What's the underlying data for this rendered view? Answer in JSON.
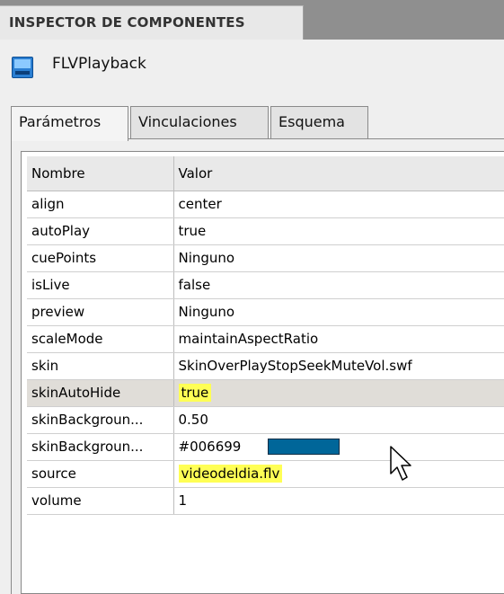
{
  "panel": {
    "title": "INSPECTOR DE COMPONENTES",
    "component": {
      "icon": "flv-playback-icon",
      "name": "FLVPlayback"
    }
  },
  "tabs": [
    {
      "label": "Parámetros",
      "active": true
    },
    {
      "label": "Vinculaciones",
      "active": false
    },
    {
      "label": "Esquema",
      "active": false
    }
  ],
  "params": {
    "columns": [
      "Nombre",
      "Valor"
    ],
    "rows": [
      {
        "name": "align",
        "value": "center"
      },
      {
        "name": "autoPlay",
        "value": "true"
      },
      {
        "name": "cuePoints",
        "value": "Ninguno"
      },
      {
        "name": "isLive",
        "value": "false"
      },
      {
        "name": "preview",
        "value": "Ninguno"
      },
      {
        "name": "scaleMode",
        "value": "maintainAspectRatio"
      },
      {
        "name": "skin",
        "value": "SkinOverPlayStopSeekMuteVol.swf"
      },
      {
        "name": "skinAutoHide",
        "value": "true",
        "highlighted": true
      },
      {
        "name": "skinBackgroun...",
        "value": "0.50"
      },
      {
        "name": "skinBackgroun...",
        "value": "#006699",
        "swatch_color": "#006699"
      },
      {
        "name": "source",
        "value": "videodeldia.flv",
        "highlighted": true
      },
      {
        "name": "volume",
        "value": "1"
      }
    ]
  },
  "colors": {
    "highlight": "#ffff55",
    "selected_row": "#e0ddd8",
    "swatch": "#006699"
  },
  "cursor": {
    "icon": "mouse-pointer-icon"
  }
}
